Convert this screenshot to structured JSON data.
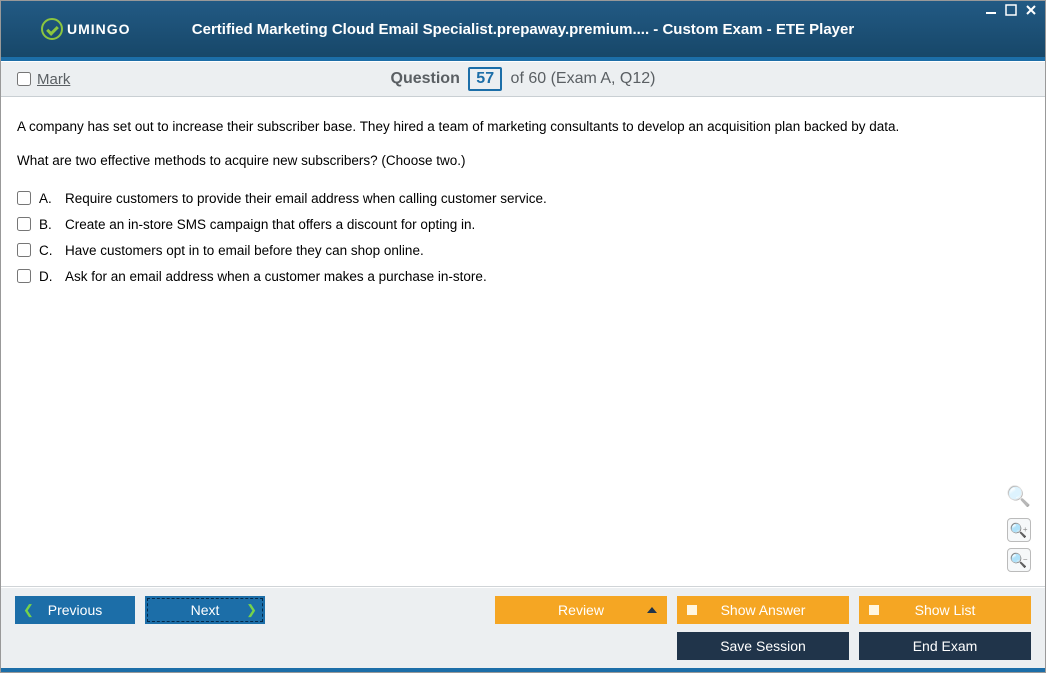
{
  "logo_text": "UMINGO",
  "window_title": "Certified Marketing Cloud Email Specialist.prepaway.premium.... - Custom Exam - ETE Player",
  "mark_label": "Mark",
  "question_label": "Question",
  "question_number": "57",
  "question_of": "of 60 (Exam A, Q12)",
  "stem": {
    "p1": "A company has set out to increase their subscriber base. They hired a team of marketing consultants to develop an acquisition plan backed by data.",
    "p2": "What are two effective methods to acquire new subscribers? (Choose two.)"
  },
  "answers": [
    {
      "letter": "A.",
      "text": "Require customers to provide their email address when calling customer service."
    },
    {
      "letter": "B.",
      "text": "Create an in-store SMS campaign that offers a discount for opting in."
    },
    {
      "letter": "C.",
      "text": "Have customers opt in to email before they can shop online."
    },
    {
      "letter": "D.",
      "text": "Ask for an email address when a customer makes a purchase in-store."
    }
  ],
  "buttons": {
    "previous": "Previous",
    "next": "Next",
    "review": "Review",
    "show_answer": "Show Answer",
    "show_list": "Show List",
    "save_session": "Save Session",
    "end_exam": "End Exam"
  }
}
